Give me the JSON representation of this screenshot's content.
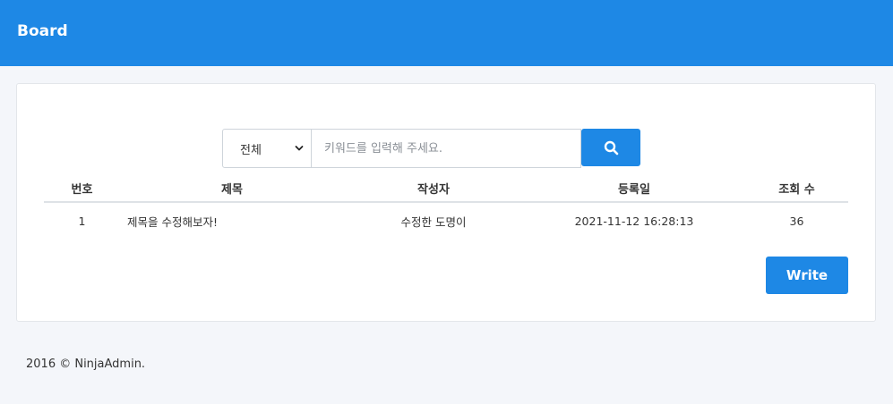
{
  "header": {
    "title": "Board"
  },
  "search": {
    "select_value": "전체",
    "placeholder": "키워드를 입력해 주세요."
  },
  "table": {
    "columns": [
      "번호",
      "제목",
      "작성자",
      "등록일",
      "조회 수"
    ],
    "rows": [
      {
        "no": "1",
        "title": "제목을 수정해보자!",
        "author": "수정한 도명이",
        "date": "2021-11-12 16:28:13",
        "views": "36"
      }
    ]
  },
  "actions": {
    "write_label": "Write"
  },
  "footer": {
    "text": "2016 © NinjaAdmin."
  },
  "colors": {
    "primary": "#1e88e5",
    "background": "#f4f6fa"
  },
  "icons": {
    "search": "search-icon",
    "select": "chevron-down-icon"
  }
}
